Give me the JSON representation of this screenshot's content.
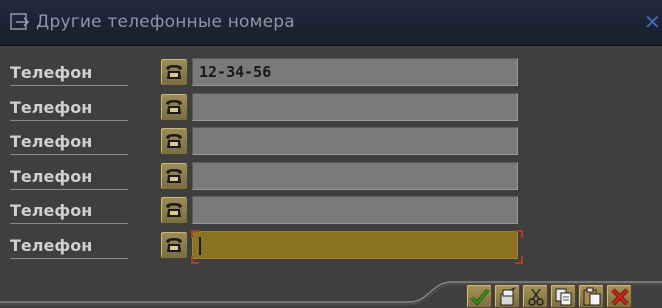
{
  "window": {
    "title": "Другие телефонные номера",
    "close_glyph": "✕"
  },
  "rows": [
    {
      "label": "Телефон",
      "value": "12-34-56",
      "active": false
    },
    {
      "label": "Телефон",
      "value": "",
      "active": false
    },
    {
      "label": "Телефон",
      "value": "",
      "active": false
    },
    {
      "label": "Телефон",
      "value": "",
      "active": false
    },
    {
      "label": "Телефон",
      "value": "",
      "active": false
    },
    {
      "label": "Телефон",
      "value": "",
      "active": true
    }
  ],
  "toolbar": {
    "buttons": [
      {
        "icon": "checkmark-icon",
        "name": "confirm-button"
      },
      {
        "icon": "save-icon",
        "name": "save-button"
      },
      {
        "icon": "cut-icon",
        "name": "cut-button"
      },
      {
        "icon": "copy-icon",
        "name": "copy-button"
      },
      {
        "icon": "paste-icon",
        "name": "paste-button"
      },
      {
        "icon": "cancel-icon",
        "name": "cancel-button"
      }
    ]
  },
  "colors": {
    "title_bar": "#1b2232",
    "active_field": "#8a7424",
    "field": "#7a7a7a",
    "close_x": "#3c6fb8",
    "cancel_red": "#c0261b",
    "confirm_green": "#3c8a1c"
  }
}
